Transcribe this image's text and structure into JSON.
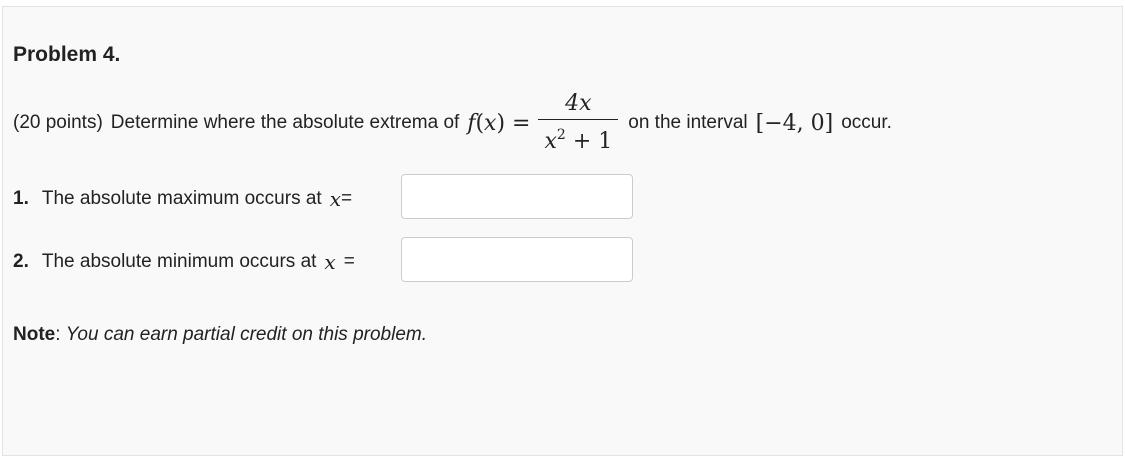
{
  "problem": {
    "title": "Problem 4.",
    "points": "(20 points)",
    "statement_start": "Determine where the absolute extrema of",
    "function_name": "f",
    "function_var": "x",
    "numerator": "4x",
    "denominator_base": "x",
    "denominator_exponent": "2",
    "denominator_rest": "+ 1",
    "statement_middle": "on the interval",
    "interval": "[−4, 0]",
    "statement_end": "occur."
  },
  "parts": [
    {
      "number": "1.",
      "label": "The absolute maximum occurs at",
      "variable": "x",
      "equals": "=",
      "value": ""
    },
    {
      "number": "2.",
      "label": "The absolute minimum occurs at",
      "variable": "x",
      "equals": "=",
      "value": ""
    }
  ],
  "note": {
    "label": "Note",
    "separator": ":",
    "text": "You can earn partial credit on this problem."
  }
}
